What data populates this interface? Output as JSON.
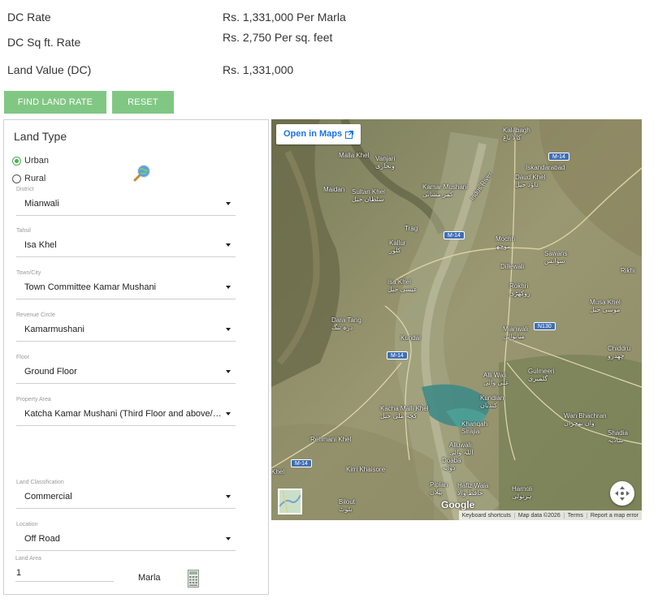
{
  "summary": {
    "dc_rate_label": "DC Rate",
    "dc_rate_value": "Rs. 1,331,000 Per Marla",
    "dc_sqft_label": "DC Sq ft. Rate",
    "dc_sqft_value": "Rs. 2,750 Per sq. feet",
    "land_value_label": "Land Value (DC)",
    "land_value_value": "Rs. 1,331,000"
  },
  "buttons": {
    "find_label": "FIND LAND RATE",
    "reset_label": "RESET",
    "color": "#81c784"
  },
  "form": {
    "title": "Land Type",
    "land_type_options": [
      {
        "label": "Urban",
        "checked": true
      },
      {
        "label": "Rural",
        "checked": false
      }
    ],
    "fields": [
      {
        "label": "District",
        "value": "Mianwali"
      },
      {
        "label": "Tahsil",
        "value": "Isa Khel"
      },
      {
        "label": "Town/City",
        "value": "Town Committee Kamar Mushani"
      },
      {
        "label": "Revenue Circle",
        "value": "Kamarmushani"
      },
      {
        "label": "Floor",
        "value": "Ground Floor"
      },
      {
        "label": "Property Area",
        "value": "Katcha Kamar Mushani (Third Floor and above/Third Floor and above)"
      },
      {
        "label": "Land Classification",
        "value": "Commercial"
      },
      {
        "label": "Location",
        "value": "Off Road"
      }
    ],
    "land_area": {
      "label": "Land Area",
      "value": "1",
      "unit": "Marla"
    },
    "icons": {
      "lookup": "magnifier-globe-icon",
      "calculator": "calculator-icon"
    }
  },
  "map": {
    "open_in_maps": "Open in Maps",
    "google": "Google",
    "attribution": [
      "Keyboard shortcuts",
      "Map data ©2026",
      "Terms",
      "Report a map error"
    ],
    "labels": [
      {
        "id": "kalabagh",
        "en": "Kalabagh",
        "ur": "کالا باغ"
      },
      {
        "id": "malla-khel",
        "en": "Malla Khel",
        "ur": ""
      },
      {
        "id": "vanjari",
        "en": "Vanjari",
        "ur": "ونجاری"
      },
      {
        "id": "iskandarabad",
        "en": "Iskandarabad",
        "ur": ""
      },
      {
        "id": "daud-khel",
        "en": "Daud Khel",
        "ur": "داؤد خیل"
      },
      {
        "id": "maidan",
        "en": "Maidan",
        "ur": ""
      },
      {
        "id": "sultan-khel",
        "en": "Sultan Khel",
        "ur": "سلطان خیل"
      },
      {
        "id": "kamar-mushani",
        "en": "Kamar Mushani",
        "ur": "کمر مشانی"
      },
      {
        "id": "indus-river",
        "en": "Indus River",
        "ur": ""
      },
      {
        "id": "trag",
        "en": "Trag",
        "ur": ""
      },
      {
        "id": "kallur",
        "en": "Kallur",
        "ur": "کلور"
      },
      {
        "id": "mochh",
        "en": "Mochh",
        "ur": "موچھ"
      },
      {
        "id": "sawans",
        "en": "Sawans",
        "ur": "سوانس"
      },
      {
        "id": "dillewali",
        "en": "Dillewali",
        "ur": ""
      },
      {
        "id": "rikhi",
        "en": "Rikhi",
        "ur": ""
      },
      {
        "id": "isa-khel",
        "en": "Isa Khel",
        "ur": "عیسی خیل"
      },
      {
        "id": "rokhri",
        "en": "Rokhri",
        "ur": "روکھڑی"
      },
      {
        "id": "musa-khel",
        "en": "Musa Khel",
        "ur": "موسی خیل"
      },
      {
        "id": "dara-tang",
        "en": "Dara Tang",
        "ur": "درہ تنگ"
      },
      {
        "id": "kundal",
        "en": "Kundal",
        "ur": ""
      },
      {
        "id": "mianwali",
        "en": "Mianwali",
        "ur": "میانوالی"
      },
      {
        "id": "chiddru",
        "en": "Chiddru",
        "ur": "چھدرو"
      },
      {
        "id": "gulmeeri",
        "en": "Gulmeeri",
        "ur": "گلمیری"
      },
      {
        "id": "alli-wali",
        "en": "Alli Wali",
        "ur": "علی والی"
      },
      {
        "id": "kundian",
        "en": "Kundian",
        "ur": "کندیاں"
      },
      {
        "id": "kacha-malli-khel",
        "en": "Kacha Malli Khel",
        "ur": "کچہ ملی خیل"
      },
      {
        "id": "khanqah-sirajia",
        "en": "Khanqah Sirajia",
        "ur": ""
      },
      {
        "id": "wan-bhachran",
        "en": "Wan Bhachran",
        "ur": "واں بھچراں"
      },
      {
        "id": "shadia",
        "en": "Shadia",
        "ur": "شادیہ"
      },
      {
        "id": "rehmani-khel",
        "en": "Rehmani Khel",
        "ur": ""
      },
      {
        "id": "alluwali",
        "en": "Alluwali",
        "ur": "اللہ والی"
      },
      {
        "id": "doaba",
        "en": "Doaba",
        "ur": "دوآبہ"
      },
      {
        "id": "kirri-khaisore",
        "en": "Kirri Khaisore",
        "ur": ""
      },
      {
        "id": "piplan",
        "en": "Piplan",
        "ur": "پپلاں"
      },
      {
        "id": "hafiz-wala",
        "en": "Hafiz Wala",
        "ur": "حافظ والا"
      },
      {
        "id": "harnoli",
        "en": "Harnoli",
        "ur": "ہرنولی"
      },
      {
        "id": "bilout",
        "en": "Bilout",
        "ur": "بلوٹ"
      },
      {
        "id": "kot-khel",
        "en": "Khel",
        "ur": ""
      }
    ],
    "shields": [
      "M-14",
      "M-14",
      "M-14",
      "N130",
      "M-14"
    ]
  }
}
